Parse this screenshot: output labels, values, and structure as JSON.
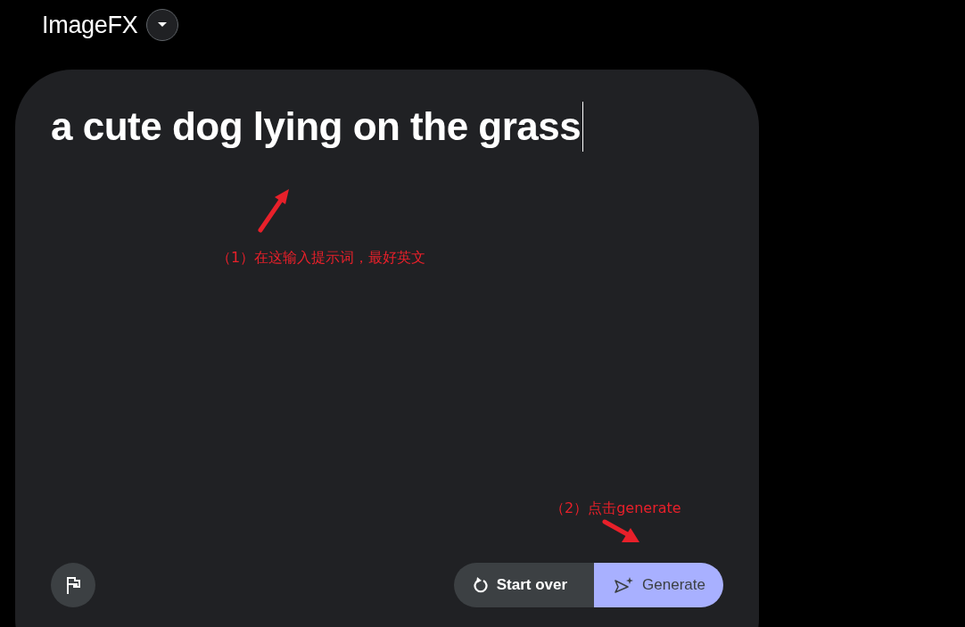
{
  "header": {
    "title": "ImageFX"
  },
  "prompt": {
    "value": "a cute dog lying on the grass"
  },
  "annotations": [
    {
      "text": "（1）在这输入提示词，最好英文"
    },
    {
      "text": "（2）点击generate"
    }
  ],
  "buttons": [
    {
      "kind": "reset",
      "label": "Start over"
    },
    {
      "kind": "generate",
      "label": "Generate"
    }
  ]
}
